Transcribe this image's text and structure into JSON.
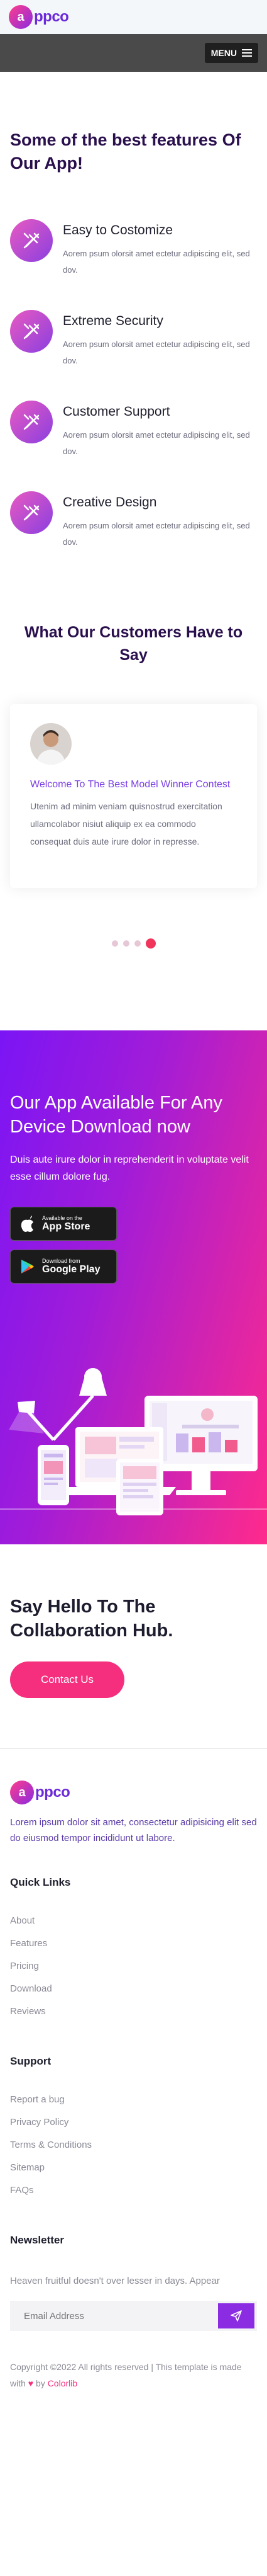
{
  "header": {
    "logo_initial": "a",
    "logo_text": "ppco",
    "menu_label": "MENU"
  },
  "features": {
    "heading": "Some of the best features Of Our App!",
    "items": [
      {
        "title": "Easy to Costomize",
        "desc": "Aorem psum olorsit amet ectetur adipiscing elit, sed dov."
      },
      {
        "title": "Extreme Security",
        "desc": "Aorem psum olorsit amet ectetur adipiscing elit, sed dov."
      },
      {
        "title": "Customer Support",
        "desc": "Aorem psum olorsit amet ectetur adipiscing elit, sed dov."
      },
      {
        "title": "Creative Design",
        "desc": "Aorem psum olorsit amet ectetur adipiscing elit, sed dov."
      }
    ]
  },
  "testimonials": {
    "heading": "What Our Customers Have to Say",
    "card_title": "Welcome To The Best Model Winner Contest",
    "card_text": "Utenim ad minim veniam quisnostrud exercitation ullamcolabor nisiut aliquip ex ea commodo consequat duis aute irure dolor in represse.",
    "active_dot": 4
  },
  "download": {
    "heading": "Our App Available For Any Device Download now",
    "text": "Duis aute irure dolor in reprehenderit in voluptate velit esse cillum dolore fug.",
    "app_store_small": "Available on the",
    "app_store_big": "App Store",
    "play_small": "Download from",
    "play_big": "Google Play"
  },
  "collab": {
    "heading": "Say Hello To The Collaboration Hub.",
    "button": "Contact Us"
  },
  "footer": {
    "about": "Lorem ipsum dolor sit amet, consectetur adipisicing elit sed do eiusmod tempor incididunt ut labore.",
    "quick_links_title": "Quick Links",
    "quick_links": [
      "About",
      "Features",
      "Pricing",
      "Download",
      "Reviews"
    ],
    "support_title": "Support",
    "support_links": [
      "Report a bug",
      "Privacy Policy",
      "Terms & Conditions",
      "Sitemap",
      "FAQs"
    ],
    "newsletter_title": "Newsletter",
    "newsletter_text": "Heaven fruitful doesn't over lesser in days. Appear",
    "newsletter_placeholder": "Email Address",
    "copyright_prefix": "Copyright ©2022 All rights reserved | This template is made with",
    "copyright_by": "by",
    "copyright_brand": "Colorlib"
  },
  "colors": {
    "accent": "#7b3fe4",
    "pink": "#f52f7e",
    "dark_purple": "#2a0f4d"
  }
}
